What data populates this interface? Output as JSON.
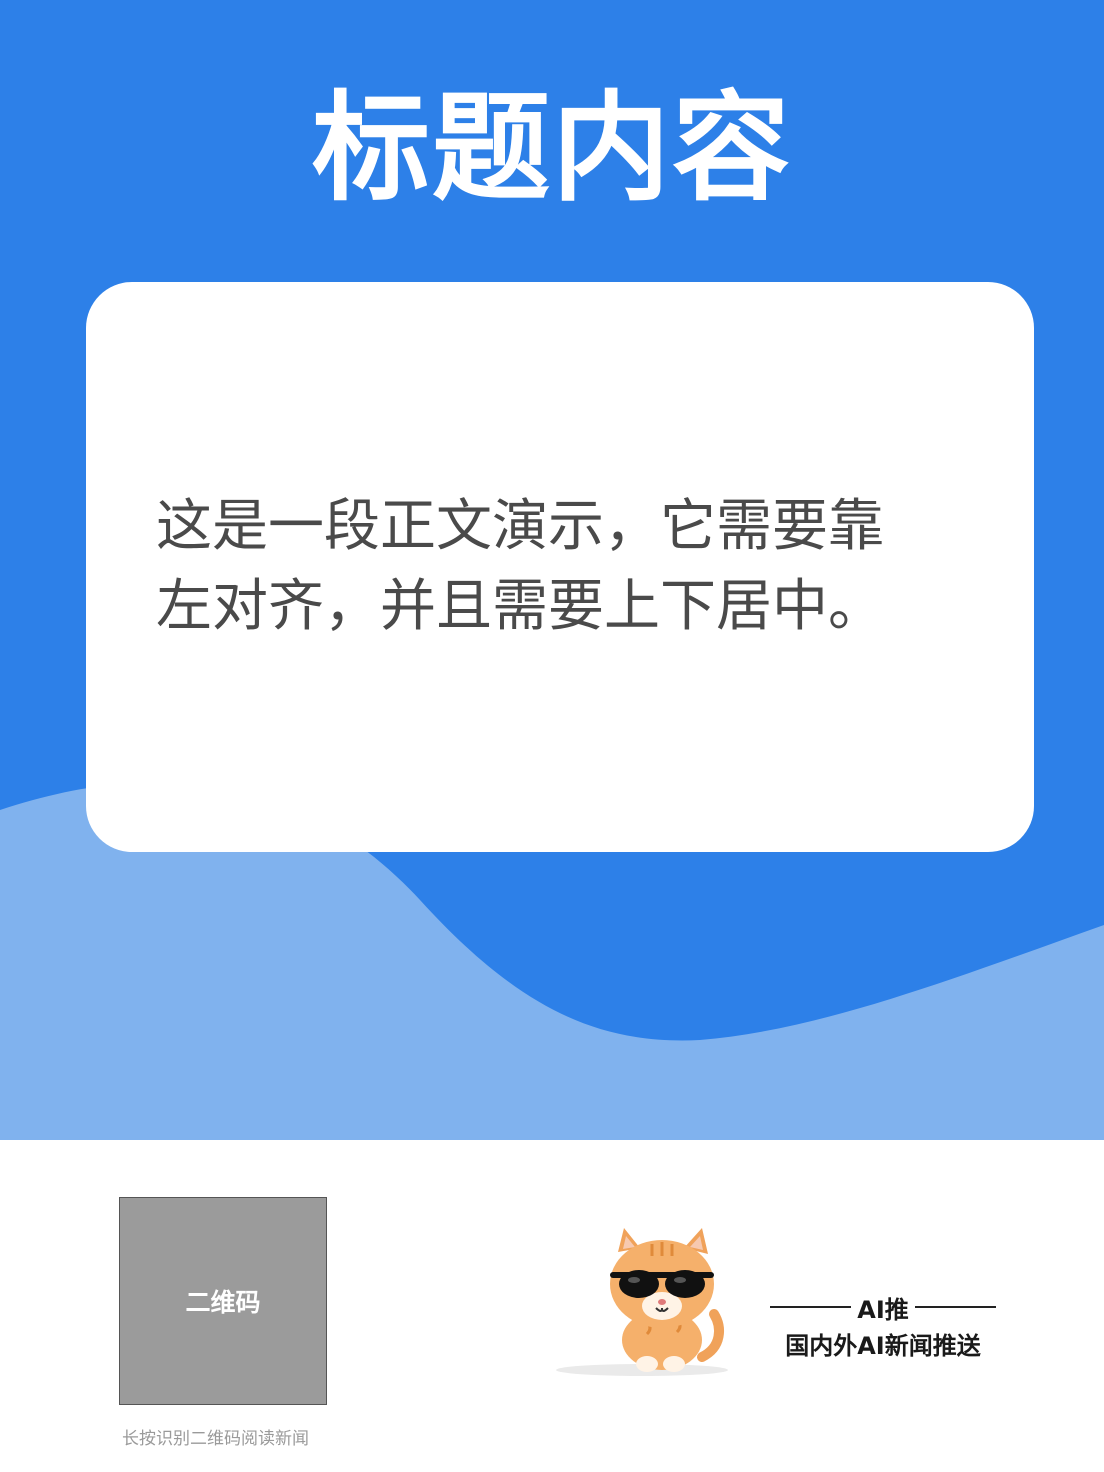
{
  "header": {
    "title": "标题内容"
  },
  "card": {
    "body_text": "这是一段正文演示，它需要靠左对齐，并且需要上下居中。"
  },
  "footer": {
    "qr_placeholder": "二维码",
    "qr_hint": "长按识别二维码阅读新闻",
    "mascot_icon": "cat-with-sunglasses-icon",
    "brand_name": "AI推",
    "brand_slogan": "国内外AI新闻推送"
  },
  "colors": {
    "primary_blue": "#2d80e8",
    "light_blue": "#80b2ee",
    "text_gray": "#4a4a4a",
    "qr_gray": "#9b9b9b"
  }
}
